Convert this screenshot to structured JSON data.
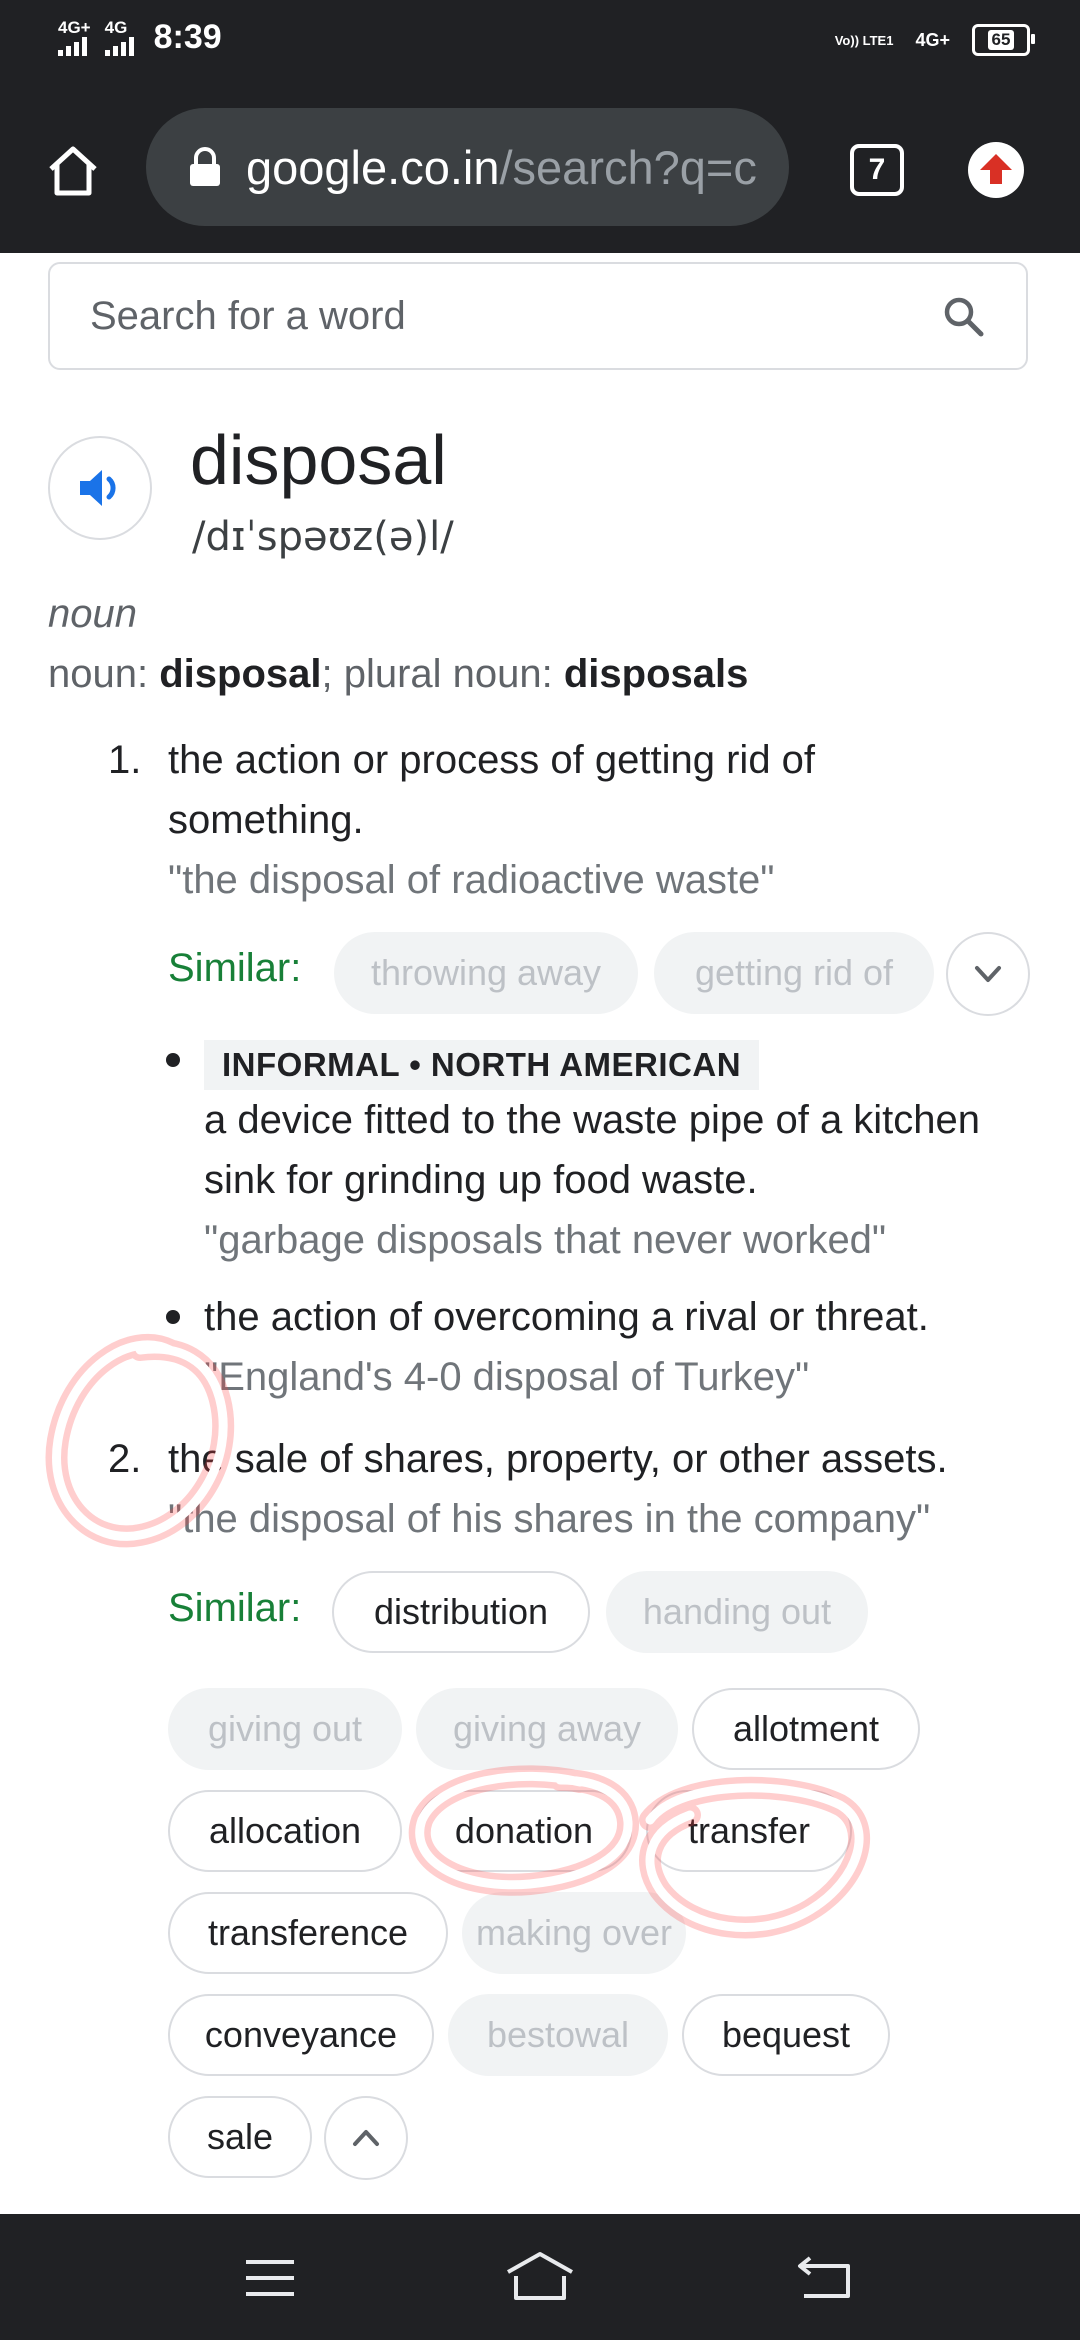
{
  "status_bar": {
    "network_1": "4G+",
    "network_2": "4G",
    "time": "8:39",
    "volte_label": "Vo)) LTE1",
    "network_3": "4G+",
    "battery": "65"
  },
  "browser": {
    "url_host": "google.co.in",
    "url_path": "/search?q=c",
    "tab_count": "7"
  },
  "dictionary": {
    "search_placeholder": "Search for a word",
    "word": "disposal",
    "phonetic": "/dɪˈspəʊz(ə)l/",
    "part_of_speech": "noun",
    "forms_prefix": "noun: ",
    "forms_word": "disposal",
    "forms_mid": "; plural noun: ",
    "forms_plural": "disposals",
    "similar_label": "Similar:",
    "senses": [
      {
        "number": "1.",
        "definition_line1": "the action or process of getting rid of",
        "definition_line2": "something.",
        "example": "\"the disposal of radioactive waste\"",
        "similar": [
          {
            "text": "throwing away",
            "state": "disabled"
          },
          {
            "text": "getting rid of",
            "state": "disabled"
          }
        ]
      },
      {
        "number": "2.",
        "definition": "the sale of shares, property, or other assets.",
        "example": "\"the disposal of his shares in the company\"",
        "similar": [
          {
            "text": "distribution",
            "state": "enabled"
          },
          {
            "text": "handing out",
            "state": "disabled"
          },
          {
            "text": "giving out",
            "state": "disabled"
          },
          {
            "text": "giving away",
            "state": "disabled"
          },
          {
            "text": "allotment",
            "state": "enabled"
          },
          {
            "text": "allocation",
            "state": "enabled"
          },
          {
            "text": "donation",
            "state": "enabled"
          },
          {
            "text": "transfer",
            "state": "enabled"
          },
          {
            "text": "transference",
            "state": "enabled"
          },
          {
            "text": "making over",
            "state": "disabled"
          },
          {
            "text": "conveyance",
            "state": "enabled"
          },
          {
            "text": "bestowal",
            "state": "disabled"
          },
          {
            "text": "bequest",
            "state": "enabled"
          },
          {
            "text": "sale",
            "state": "enabled"
          }
        ]
      }
    ],
    "subsenses": [
      {
        "label": "INFORMAL • NORTH AMERICAN",
        "line1": "a device fitted to the waste pipe of a kitchen",
        "line2": "sink for grinding up food waste.",
        "example": "\"garbage disposals that never worked\""
      },
      {
        "line1": "the action of overcoming a rival or threat.",
        "example": "\"England's 4-0 disposal of Turkey\""
      }
    ]
  },
  "colors": {
    "chrome_bg": "#202124",
    "similar_green": "#188038",
    "speaker_blue": "#1a73e8",
    "annotation_red": "#ff3b3b"
  },
  "icons": [
    "home-icon",
    "lock-icon",
    "tab-switcher-icon",
    "update-arrow-icon",
    "search-icon",
    "speaker-icon",
    "chevron-down-icon",
    "chevron-up-icon",
    "menu-icon",
    "nav-home-icon",
    "back-icon"
  ]
}
